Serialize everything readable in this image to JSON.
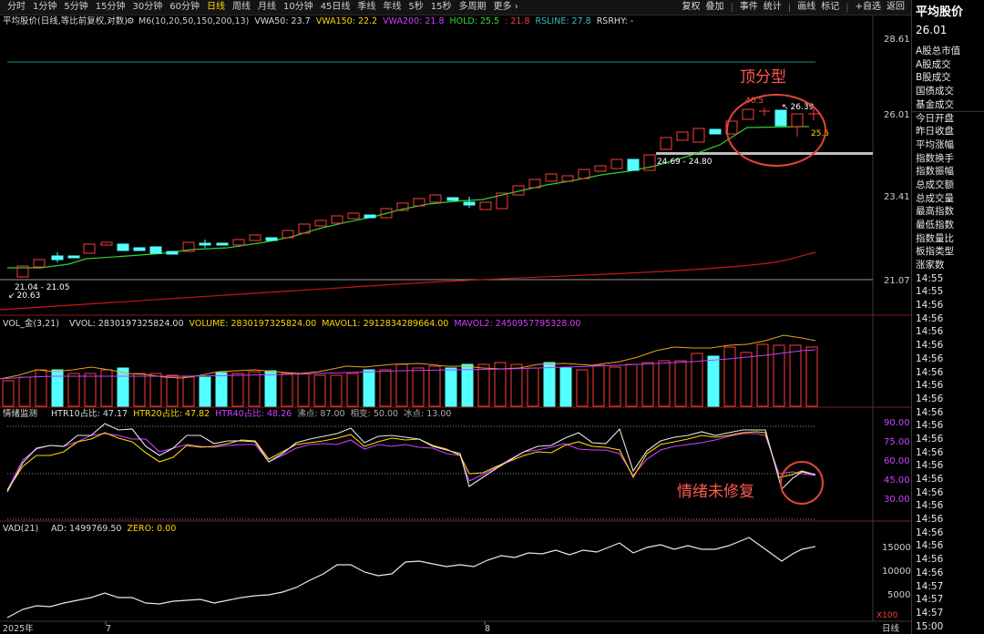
{
  "toolbar": {
    "periods": [
      "分时",
      "1分钟",
      "5分钟",
      "15分钟",
      "30分钟",
      "60分钟",
      "日线",
      "周线",
      "月线",
      "10分钟",
      "45日线",
      "季线",
      "年线",
      "5秒",
      "15秒",
      "多周期",
      "更多 ›"
    ],
    "active_period": "日线",
    "tools": [
      "复权",
      "叠加",
      "事件",
      "统计",
      "画线",
      "标记",
      "+自选",
      "返回"
    ]
  },
  "main_panel": {
    "title": "平均股价(日线,等比前复权,对数)",
    "indicators": [
      {
        "label": "M6(10,20,50,150,200,13)",
        "color": "#cfcfcf"
      },
      {
        "label": "VWA50: 23.7",
        "color": "#dcdcdc"
      },
      {
        "label": "VWA150: 22.2",
        "color": "#ffd700"
      },
      {
        "label": "VWA200: 21.8",
        "color": "#d040ff"
      },
      {
        "label": "HOLD: 25.5",
        "color": "#33dd33"
      },
      {
        "label": ": 21.8",
        "color": "#ff3b3b"
      },
      {
        "label": "RSLINE: 27.8",
        "color": "#33c0c0"
      },
      {
        "label": "RSRHY: -",
        "color": "#dcdcdc"
      }
    ],
    "price_ticks": [
      "28.61",
      "26.01",
      "23.41",
      "21.07"
    ],
    "labels": {
      "range_low": "21.04 - 21.05",
      "low_price": "20.63",
      "range_mid": "24.69 - 24.80",
      "peak_left": "40.5",
      "peak_high": "26.39",
      "hold_value": "25.5"
    },
    "annotation_top": "顶分型"
  },
  "volume_panel": {
    "title": "VOL_金(3,21)",
    "indicators": [
      {
        "label": "VVOL: 2830197325824.00",
        "color": "#dcdcdc"
      },
      {
        "label": "VOLUME: 2830197325824.00",
        "color": "#ffd700"
      },
      {
        "label": "MAVOL1: 2912834289664.00",
        "color": "#ffd700"
      },
      {
        "label": "MAVOL2: 2450957795328.00",
        "color": "#d040ff"
      }
    ]
  },
  "sentiment_panel": {
    "title": "情绪监测",
    "indicators": [
      {
        "label": "HTR10占比: 47.17",
        "color": "#dcdcdc"
      },
      {
        "label": "HTR20占比: 47.82",
        "color": "#ffd700"
      },
      {
        "label": "HTR40占比: 48.26",
        "color": "#d040ff"
      },
      {
        "label": "沸点: 87.00",
        "color": "#aaaaaa"
      },
      {
        "label": "相变: 50.00",
        "color": "#aaaaaa"
      },
      {
        "label": "冰点: 13.00",
        "color": "#aaaaaa"
      }
    ],
    "ticks": [
      "90.00",
      "75.00",
      "60.00",
      "45.00",
      "30.00"
    ],
    "annotation": "情绪未修复"
  },
  "vad_panel": {
    "title": "VAD(21)",
    "indicators": [
      {
        "label": "AD: 1499769.50",
        "color": "#dcdcdc"
      },
      {
        "label": "ZERO: 0.00",
        "color": "#ffd700"
      }
    ],
    "ticks": [
      "15000",
      "10000",
      "5000"
    ],
    "scale_label": "X100"
  },
  "date_axis": {
    "labels": [
      "2025年",
      "7",
      "8"
    ],
    "period_label": "日线"
  },
  "right_panel": {
    "title": "平均股价",
    "value": "26.01",
    "items": [
      "A股总市值",
      "A股成交",
      "B股成交",
      "国债成交",
      "基金成交",
      "今日开盘",
      "昨日收盘",
      "平均涨幅",
      "指数换手",
      "指数振幅",
      "总成交额",
      "总成交量",
      "最高指数",
      "最低指数",
      "指数量比",
      "板指类型",
      "涨家数",
      "14:55",
      "14:55",
      "14:56",
      "14:56",
      "14:56",
      "14:56",
      "14:56",
      "14:56",
      "14:56",
      "14:56",
      "14:56",
      "14:56",
      "14:56",
      "14:56",
      "14:56",
      "14:56",
      "14:56",
      "14:56",
      "14:56",
      "14:56",
      "14:56",
      "14:56",
      "14:56",
      "14:57",
      "14:57",
      "14:57",
      "15:00",
      "15:00",
      "15:00"
    ]
  },
  "colors": {
    "up": "#ff3b3b",
    "down": "#54ffff",
    "hold": "#33dd33",
    "annotation": "#ff5a4f"
  }
}
